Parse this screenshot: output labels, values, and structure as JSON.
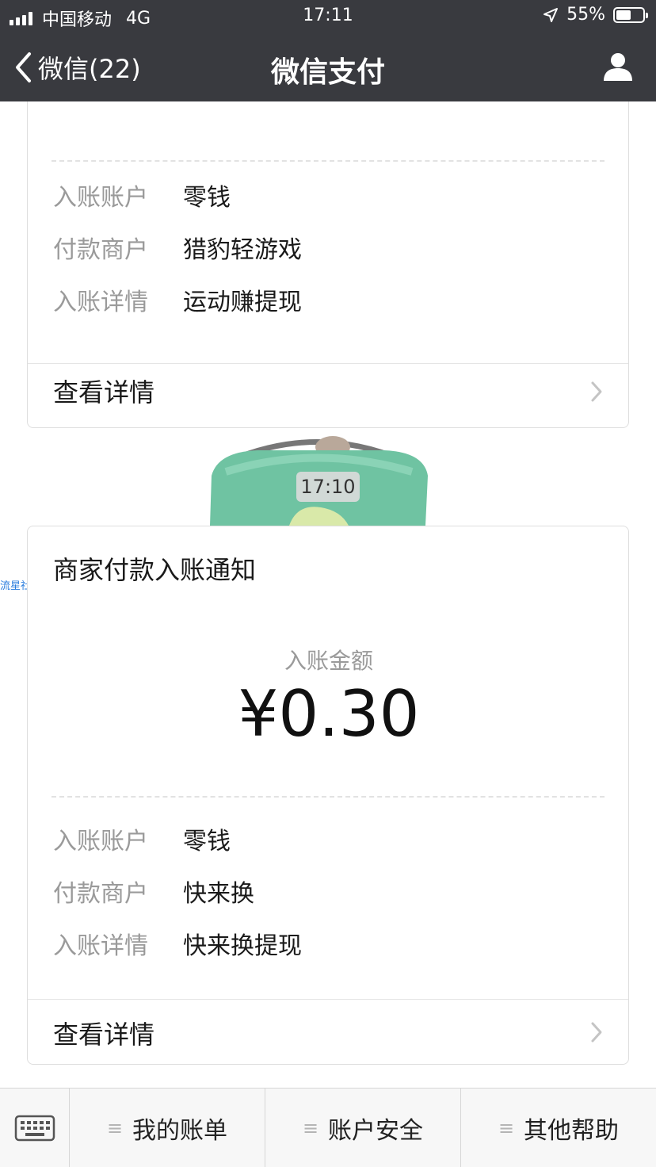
{
  "status_bar": {
    "carrier": "中国移动",
    "network": "4G",
    "time": "17:11",
    "battery": "55%",
    "battery_level": 0.55
  },
  "nav": {
    "back_label": "微信(22)",
    "title": "微信支付"
  },
  "card1": {
    "rows": [
      {
        "label": "入账账户",
        "value": "零钱"
      },
      {
        "label": "付款商户",
        "value": "猎豹轻游戏"
      },
      {
        "label": "入账详情",
        "value": "运动赚提现"
      }
    ],
    "detail_label": "查看详情"
  },
  "timestamp": "17:10",
  "watermark": "流星社区",
  "card2": {
    "title": "商家付款入账通知",
    "amount_label": "入账金额",
    "amount": "¥0.30",
    "rows": [
      {
        "label": "入账账户",
        "value": "零钱"
      },
      {
        "label": "付款商户",
        "value": "快来换"
      },
      {
        "label": "入账详情",
        "value": "快来换提现"
      }
    ],
    "detail_label": "查看详情"
  },
  "bottom_menu": [
    {
      "label": "我的账单"
    },
    {
      "label": "账户安全"
    },
    {
      "label": "其他帮助"
    }
  ],
  "colors": {
    "header": "#393a3f",
    "label_gray": "#9a9a9a",
    "watermark_blue": "#2a7dde"
  }
}
